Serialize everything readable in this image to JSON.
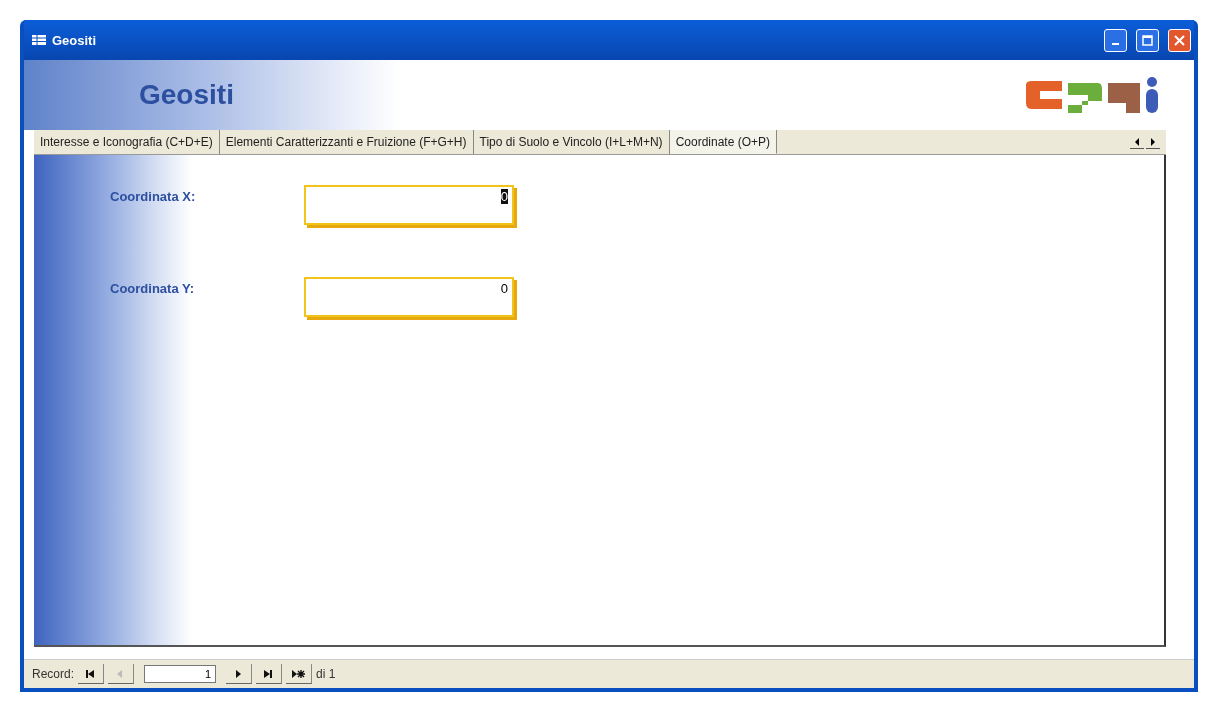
{
  "window": {
    "title": "Geositi"
  },
  "header": {
    "title": "Geositi"
  },
  "tabs": [
    {
      "label": "Interesse e Iconografia (C+D+E)",
      "selected": false
    },
    {
      "label": "Elementi Caratterizzanti e Fruizione (F+G+H)",
      "selected": false
    },
    {
      "label": "Tipo di Suolo e Vincolo (I+L+M+N)",
      "selected": false
    },
    {
      "label": "Coordinate (O+P)",
      "selected": true
    }
  ],
  "fields": [
    {
      "label": "Coordinata X:",
      "value": "0",
      "selected": true
    },
    {
      "label": "Coordinata Y:",
      "value": "0",
      "selected": false
    }
  ],
  "record_bar": {
    "label": "Record:",
    "current": "1",
    "total": "di 1",
    "buttons": [
      {
        "kind": "first",
        "disabled": false
      },
      {
        "kind": "prev",
        "disabled": true
      },
      {
        "kind": "next",
        "disabled": false
      },
      {
        "kind": "last",
        "disabled": false
      },
      {
        "kind": "new",
        "disabled": false
      }
    ]
  }
}
